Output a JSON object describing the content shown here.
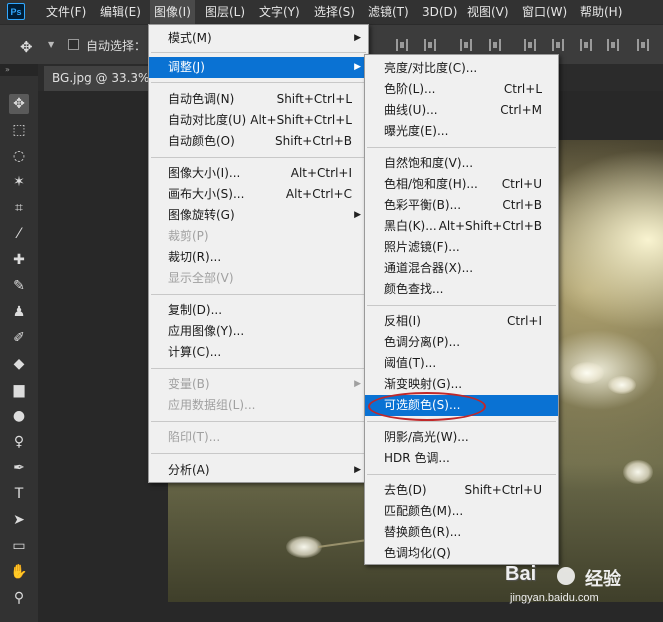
{
  "app": {
    "logo": "Ps"
  },
  "menubar": [
    {
      "label": "文件(F)",
      "active": false
    },
    {
      "label": "编辑(E)",
      "active": false
    },
    {
      "label": "图像(I)",
      "active": true
    },
    {
      "label": "图层(L)",
      "active": false
    },
    {
      "label": "文字(Y)",
      "active": false
    },
    {
      "label": "选择(S)",
      "active": false
    },
    {
      "label": "滤镜(T)",
      "active": false
    },
    {
      "label": "3D(D)",
      "active": false
    },
    {
      "label": "视图(V)",
      "active": false
    },
    {
      "label": "窗口(W)",
      "active": false
    },
    {
      "label": "帮助(H)",
      "active": false
    }
  ],
  "options": {
    "auto_select_label": "自动选择："
  },
  "toolbar_collapse": "»",
  "document_tab": "BG.jpg @ 33.3%(R",
  "image_menu": [
    {
      "label": "模式(M)",
      "shortcut": "",
      "submenu": true,
      "disabled": false
    },
    {
      "label": "调整(J)",
      "shortcut": "",
      "submenu": true,
      "disabled": false,
      "highlighted": true
    },
    {
      "label": "自动色调(N)",
      "shortcut": "Shift+Ctrl+L"
    },
    {
      "label": "自动对比度(U)",
      "shortcut": "Alt+Shift+Ctrl+L"
    },
    {
      "label": "自动颜色(O)",
      "shortcut": "Shift+Ctrl+B"
    },
    {
      "label": "图像大小(I)...",
      "shortcut": "Alt+Ctrl+I"
    },
    {
      "label": "画布大小(S)...",
      "shortcut": "Alt+Ctrl+C"
    },
    {
      "label": "图像旋转(G)",
      "shortcut": "",
      "submenu": true
    },
    {
      "label": "裁剪(P)",
      "shortcut": "",
      "disabled": true
    },
    {
      "label": "裁切(R)...",
      "shortcut": ""
    },
    {
      "label": "显示全部(V)",
      "shortcut": "",
      "disabled": true
    },
    {
      "label": "复制(D)...",
      "shortcut": ""
    },
    {
      "label": "应用图像(Y)...",
      "shortcut": ""
    },
    {
      "label": "计算(C)...",
      "shortcut": ""
    },
    {
      "label": "变量(B)",
      "shortcut": "",
      "submenu": true,
      "disabled": true
    },
    {
      "label": "应用数据组(L)...",
      "shortcut": "",
      "disabled": true
    },
    {
      "label": "陷印(T)...",
      "shortcut": "",
      "disabled": true
    },
    {
      "label": "分析(A)",
      "shortcut": "",
      "submenu": true
    }
  ],
  "adjust_menu": [
    {
      "label": "亮度/对比度(C)...",
      "shortcut": ""
    },
    {
      "label": "色阶(L)...",
      "shortcut": "Ctrl+L"
    },
    {
      "label": "曲线(U)...",
      "shortcut": "Ctrl+M"
    },
    {
      "label": "曝光度(E)...",
      "shortcut": ""
    },
    {
      "label": "自然饱和度(V)...",
      "shortcut": ""
    },
    {
      "label": "色相/饱和度(H)...",
      "shortcut": "Ctrl+U"
    },
    {
      "label": "色彩平衡(B)...",
      "shortcut": "Ctrl+B"
    },
    {
      "label": "黑白(K)...",
      "shortcut": "Alt+Shift+Ctrl+B"
    },
    {
      "label": "照片滤镜(F)...",
      "shortcut": ""
    },
    {
      "label": "通道混合器(X)...",
      "shortcut": ""
    },
    {
      "label": "颜色查找...",
      "shortcut": ""
    },
    {
      "label": "反相(I)",
      "shortcut": "Ctrl+I"
    },
    {
      "label": "色调分离(P)...",
      "shortcut": ""
    },
    {
      "label": "阈值(T)...",
      "shortcut": ""
    },
    {
      "label": "渐变映射(G)...",
      "shortcut": ""
    },
    {
      "label": "可选颜色(S)...",
      "shortcut": "",
      "highlighted": true
    },
    {
      "label": "阴影/高光(W)...",
      "shortcut": ""
    },
    {
      "label": "HDR 色调...",
      "shortcut": ""
    },
    {
      "label": "去色(D)",
      "shortcut": "Shift+Ctrl+U"
    },
    {
      "label": "匹配颜色(M)...",
      "shortcut": ""
    },
    {
      "label": "替换颜色(R)...",
      "shortcut": ""
    },
    {
      "label": "色调均化(Q)",
      "shortcut": ""
    }
  ],
  "watermark": {
    "brand": "Bai",
    "brand2": "经验",
    "url": "jingyan.baidu.com"
  },
  "colors": {
    "highlight": "#0a72d3",
    "annotation": "#c0282a"
  }
}
